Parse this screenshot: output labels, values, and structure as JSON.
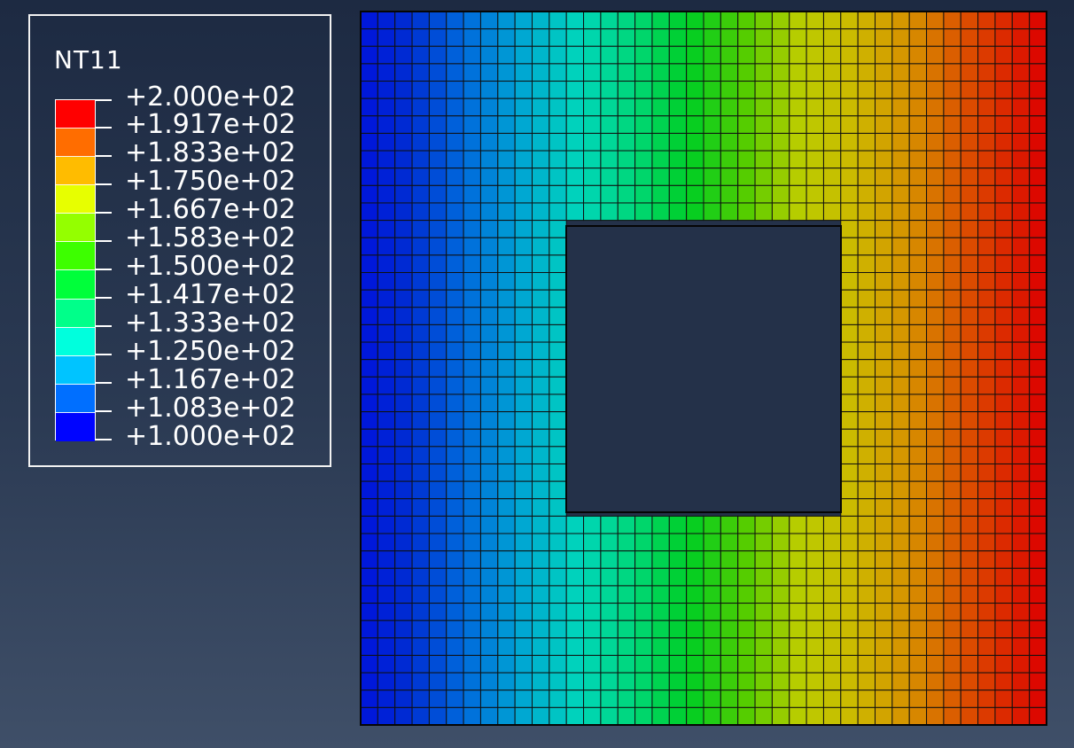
{
  "legend": {
    "variable": "NT11",
    "values": [
      "+2.000e+02",
      "+1.917e+02",
      "+1.833e+02",
      "+1.750e+02",
      "+1.667e+02",
      "+1.583e+02",
      "+1.500e+02",
      "+1.417e+02",
      "+1.333e+02",
      "+1.250e+02",
      "+1.167e+02",
      "+1.083e+02",
      "+1.000e+02"
    ],
    "band_colors": [
      "#ff0000",
      "#ff6d00",
      "#ffbc00",
      "#e7ff00",
      "#94ff00",
      "#3dff00",
      "#00ff3a",
      "#00ff8a",
      "#00ffdd",
      "#00c4ff",
      "#006fff",
      "#0004ff"
    ]
  },
  "model": {
    "description_visible": "rectangular plate with square hole"
  }
}
